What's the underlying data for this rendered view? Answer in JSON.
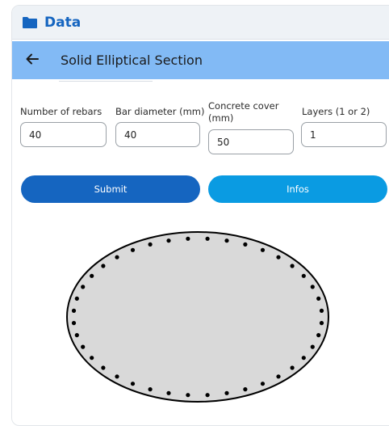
{
  "header": {
    "title": "Data",
    "icon": "folder-icon"
  },
  "appbar": {
    "title": "Solid Elliptical Section",
    "back_icon": "arrow-left-icon"
  },
  "form": {
    "rebars": {
      "label": "Number of rebars",
      "value": "40"
    },
    "diameter": {
      "label": "Bar diameter (mm)",
      "value": "40"
    },
    "cover": {
      "label": "Concrete cover (mm)",
      "value": "50"
    },
    "layers": {
      "label": "Layers (1 or 2)",
      "value": "1"
    }
  },
  "buttons": {
    "submit": "Submit",
    "infos": "Infos"
  },
  "section_drawing": {
    "shape": "ellipse",
    "rebar_count": 40,
    "fill": "#d9d9d9",
    "stroke": "#000000"
  },
  "colors": {
    "header_bg": "#eef2f6",
    "brand": "#1565c0",
    "appbar_bg": "#82baf5",
    "infos_btn": "#0a9be2"
  }
}
